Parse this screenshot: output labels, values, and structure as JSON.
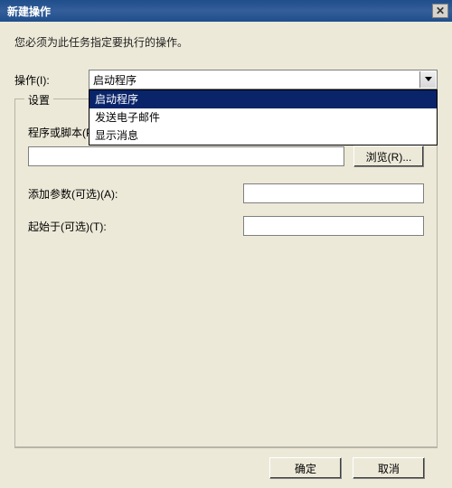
{
  "title": "新建操作",
  "instruction": "您必须为此任务指定要执行的操作。",
  "action": {
    "label": "操作(I):",
    "selected": "启动程序",
    "options": [
      "启动程序",
      "发送电子邮件",
      "显示消息"
    ]
  },
  "group": {
    "title": "设置",
    "program_label": "程序或脚本(P):",
    "program_value": "",
    "browse_label": "浏览(R)...",
    "args_label": "添加参数(可选)(A):",
    "args_value": "",
    "startin_label": "起始于(可选)(T):",
    "startin_value": ""
  },
  "footer": {
    "ok": "确定",
    "cancel": "取消"
  },
  "icons": {
    "dropdown": "chevron-down-icon",
    "close": "close-icon"
  }
}
